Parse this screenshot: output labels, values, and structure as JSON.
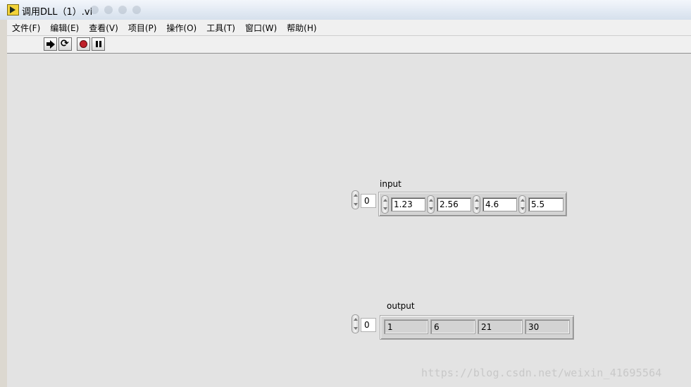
{
  "window": {
    "title": "调用DLL（1）.vi"
  },
  "menu": [
    "文件(F)",
    "编辑(E)",
    "查看(V)",
    "项目(P)",
    "操作(O)",
    "工具(T)",
    "窗口(W)",
    "帮助(H)"
  ],
  "toolbar": {
    "run_icon": "run-arrow-icon",
    "continuous_icon": "run-continuously-icon",
    "abort_icon": "abort-stop-icon",
    "pause_icon": "pause-icon"
  },
  "input_array": {
    "label": "input",
    "index": "0",
    "values": [
      "1.23",
      "2.56",
      "4.6",
      "5.5"
    ]
  },
  "output_array": {
    "label": "output",
    "index": "0",
    "values": [
      "1",
      "6",
      "21",
      "30"
    ]
  },
  "watermark": "https://blog.csdn.net/weixin_41695564",
  "colors": {
    "panel": "#e3e3e3",
    "abort": "#c0202a",
    "titlebar": "#dfe7f1"
  }
}
